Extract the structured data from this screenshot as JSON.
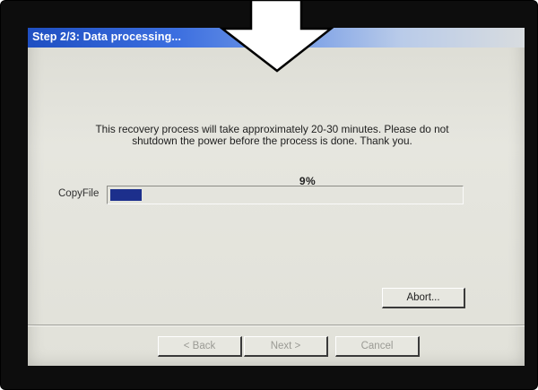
{
  "window": {
    "title": "Step 2/3: Data processing..."
  },
  "message": {
    "line1": "This recovery process will take approximately 20-30 minutes.  Please do not",
    "line2": "shutdown the power before the process is done.  Thank you."
  },
  "progress": {
    "label": "CopyFile",
    "percent_text": "9%",
    "fraction": 0.09,
    "fill_color": "#1c2f8c"
  },
  "buttons": {
    "abort": "Abort...",
    "back": "< Back",
    "next": "Next >",
    "cancel": "Cancel"
  },
  "colors": {
    "titlebar": "#2a5ed0",
    "bezel": "#0d0d0d"
  },
  "annotation": {
    "icon": "down-arrow-icon"
  }
}
